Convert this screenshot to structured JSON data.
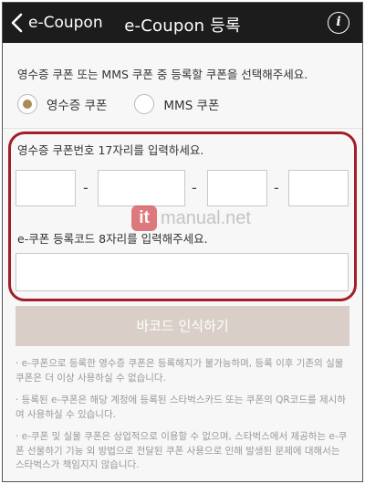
{
  "header": {
    "back_label": "e-Coupon",
    "title": "e-Coupon 등록",
    "info_icon": "i"
  },
  "main": {
    "instruction": "영수증 쿠폰 또는 MMS 쿠폰 중 등록할 쿠폰을 선택해주세요.",
    "radio_options": [
      {
        "label": "영수증 쿠폰",
        "selected": true
      },
      {
        "label": "MMS 쿠폰",
        "selected": false
      }
    ],
    "receipt_code_label": "영수증 쿠폰번호 17자리를 입력하세요.",
    "code_segments": [
      "",
      "",
      "",
      ""
    ],
    "separator": "-",
    "register_code_label": "e-쿠폰 등록코드 8자리를 입력해주세요.",
    "register_code_value": "",
    "barcode_button": "바코드 인식하기",
    "notes": [
      "· e-쿠폰으로 등록한 영수증 쿠폰은 등록해지가 불가능하며, 등록 이후 기존의 실물 쿠폰은 더 이상 사용하실 수 없습니다.",
      "· 등록된 e-쿠폰은 해당 계정에 등록된 스타벅스카드 또는 쿠폰의 QR코드를 제시하여 사용하실 수 있습니다.",
      "· e-쿠폰 및 실물 쿠폰은 상업적으로 이용할 수 없으며, 스타벅스에서 제공하는 e-쿠폰 선물하기 기능 외 방법으로 전달된 쿠폰 사용으로 인해 발생된 문제에 대해서는 스타벅스가 책임지지 않습니다."
    ]
  },
  "watermark": {
    "badge": "it",
    "text": "manual.net"
  },
  "colors": {
    "header_bg": "#1c1c1c",
    "radio_selected": "#a78c58",
    "highlight_border": "#a41e2a",
    "button_bg": "#d9cfc8"
  }
}
